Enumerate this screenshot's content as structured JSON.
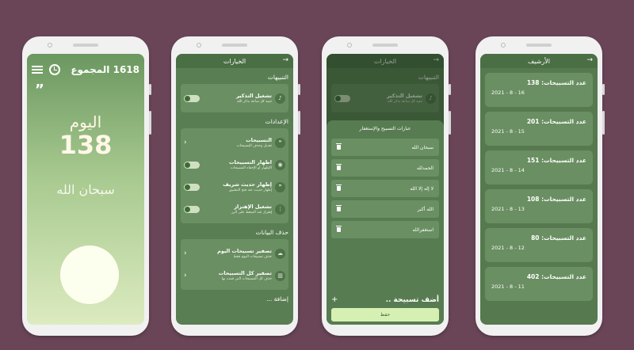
{
  "home": {
    "total_label": "1618 المجموع",
    "today_label": "اليوم",
    "count": "138",
    "dhikr": "سبحان الله",
    "quote_mark": "”"
  },
  "settings": {
    "title": "الخيارات",
    "sections": {
      "notifications": "التنبيهات",
      "settings": "الإعدادات",
      "delete_data": "حذف البيانات",
      "partial": "إضافة ..."
    },
    "reminder": {
      "title": "تشغيل التذكير",
      "sub": "تنبيه كل ساعة بذكر الله"
    },
    "tasbeehat": {
      "title": "التسبيحات",
      "sub": "تعديل وحذف التسبيحات"
    },
    "show_tasbeehat": {
      "title": "اظهار التسبيحات",
      "sub": "الإظهار أو الإخفاء التسبيحات"
    },
    "show_hadith": {
      "title": "إظهار حديث شريف",
      "sub": "إظهار حديث عند فتح التطبيق"
    },
    "vibration": {
      "title": "تشغيل الإهتزاز",
      "sub": "إهتزاز عند الضغط على الزر"
    },
    "reset_today": {
      "title": "تصفير تسبيحات اليوم",
      "sub": "حذف تسبيحات اليوم فقط"
    },
    "reset_all": {
      "title": "تصفير كل التسبيحات",
      "sub": "حذف كل التسبيحات التي قمت بها"
    }
  },
  "phrases": {
    "sheet_title": "عبارات التسبيح والإستغفار",
    "items": [
      "سبحان الله",
      "الحمدلله",
      "لا إله إلا الله",
      "الله أكبر",
      "استغفرالله"
    ],
    "add_label": "أضف تسبيحة ..",
    "save_label": "حفظ"
  },
  "archive": {
    "title": "الأرشيف",
    "items": [
      {
        "count": "عدد التسبيحات: 138",
        "date": "2021 - 8 - 16"
      },
      {
        "count": "عدد التسبيحات: 201",
        "date": "2021 - 8 - 15"
      },
      {
        "count": "عدد التسبيحات: 151",
        "date": "2021 - 8 - 14"
      },
      {
        "count": "عدد التسبيحات: 108",
        "date": "2021 - 8 - 13"
      },
      {
        "count": "عدد التسبيحات: 80",
        "date": "2021 - 8 - 12"
      },
      {
        "count": "عدد التسبيحات: 402",
        "date": "2021 - 8 - 11"
      }
    ]
  },
  "colors": {
    "background": "#6a4558",
    "primary": "#597e53",
    "accent": "#d6f0b4"
  }
}
